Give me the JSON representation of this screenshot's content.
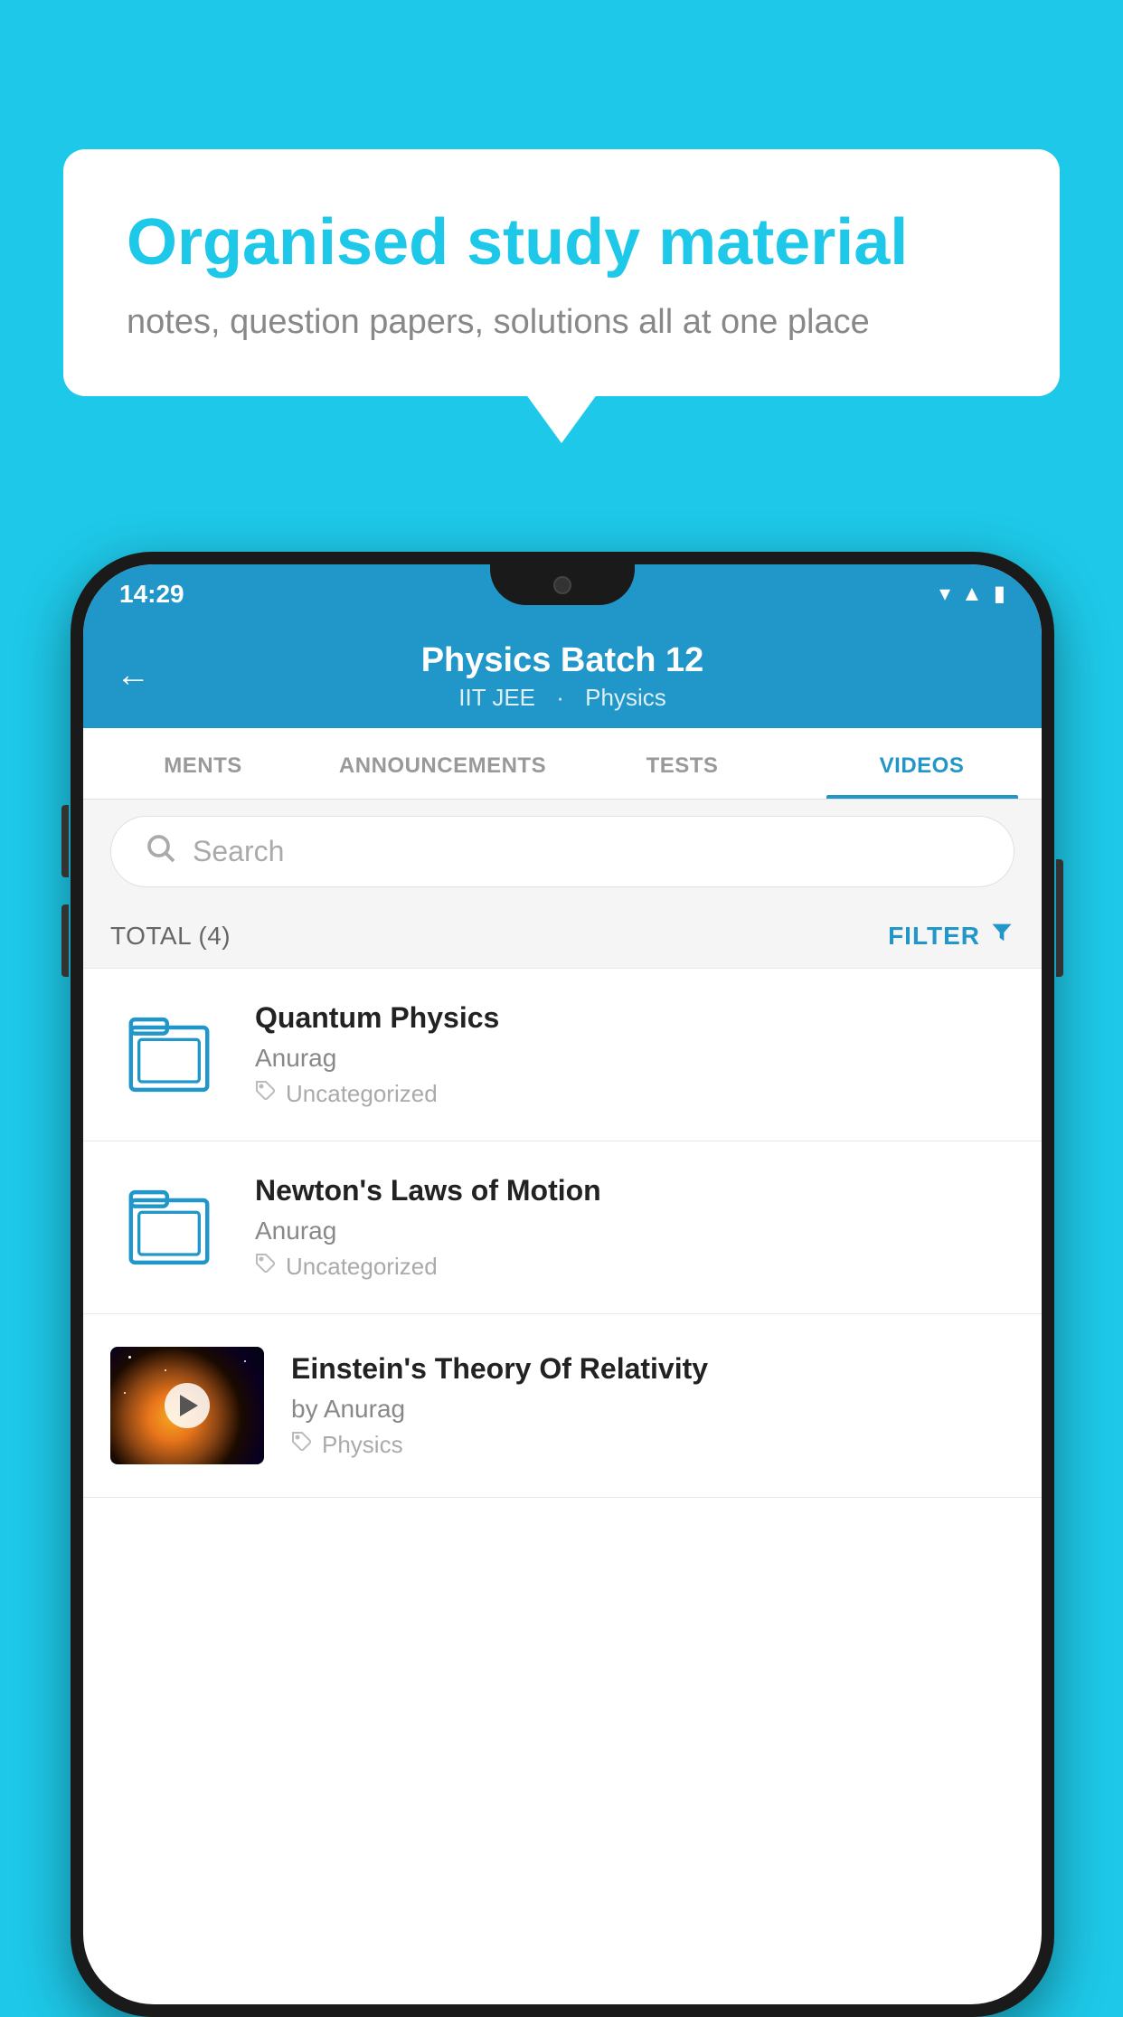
{
  "background": {
    "color": "#1ec8e8"
  },
  "speech_bubble": {
    "title": "Organised study material",
    "subtitle": "notes, question papers, solutions all at one place"
  },
  "phone": {
    "status_bar": {
      "time": "14:29",
      "icons": [
        "wifi",
        "signal",
        "battery"
      ]
    },
    "header": {
      "back_label": "←",
      "title": "Physics Batch 12",
      "subtitle_part1": "IIT JEE",
      "subtitle_separator": " ",
      "subtitle_part2": "Physics"
    },
    "tabs": [
      {
        "label": "MENTS",
        "active": false
      },
      {
        "label": "ANNOUNCEMENTS",
        "active": false
      },
      {
        "label": "TESTS",
        "active": false
      },
      {
        "label": "VIDEOS",
        "active": true
      }
    ],
    "search": {
      "placeholder": "Search"
    },
    "filter_bar": {
      "total_label": "TOTAL (4)",
      "filter_label": "FILTER"
    },
    "videos": [
      {
        "id": 1,
        "title": "Quantum Physics",
        "author": "Anurag",
        "tag": "Uncategorized",
        "type": "file",
        "has_thumbnail": false
      },
      {
        "id": 2,
        "title": "Newton's Laws of Motion",
        "author": "Anurag",
        "tag": "Uncategorized",
        "type": "file",
        "has_thumbnail": false
      },
      {
        "id": 3,
        "title": "Einstein's Theory Of Relativity",
        "author_prefix": "by",
        "author": "Anurag",
        "tag": "Physics",
        "type": "video",
        "has_thumbnail": true
      }
    ]
  }
}
